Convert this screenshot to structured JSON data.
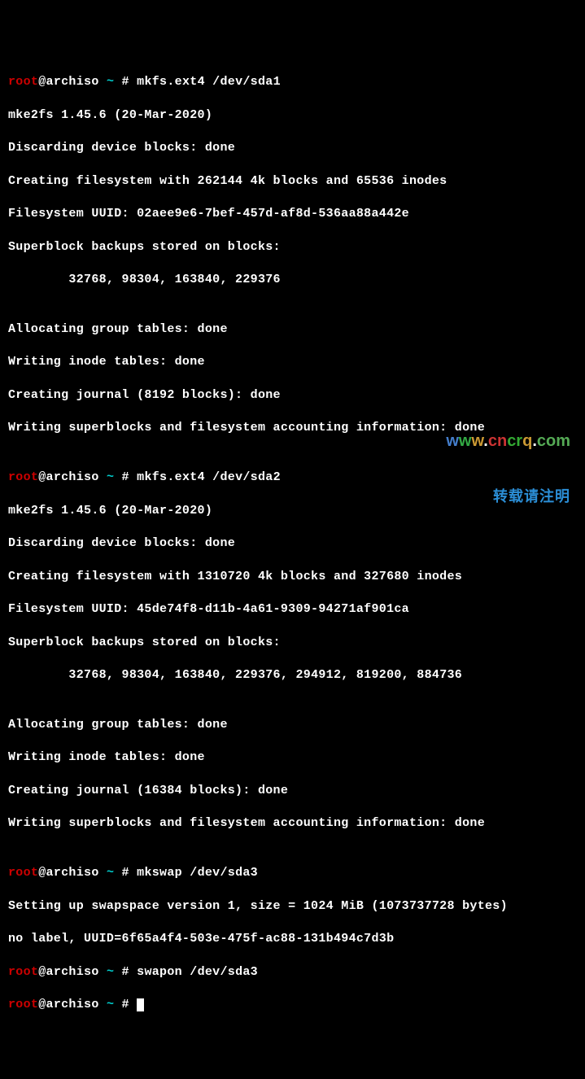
{
  "prompt1": {
    "user": "root",
    "at_host": "@archiso ",
    "tilde": "~",
    "hash": " # ",
    "cmd": "mkfs.ext4 /dev/sda1"
  },
  "block1": {
    "l1": "mke2fs 1.45.6 (20-Mar-2020)",
    "l2": "Discarding device blocks: done",
    "l3": "Creating filesystem with 262144 4k blocks and 65536 inodes",
    "l4": "Filesystem UUID: 02aee9e6-7bef-457d-af8d-536aa88a442e",
    "l5": "Superblock backups stored on blocks:",
    "l6": "        32768, 98304, 163840, 229376",
    "l7": "Allocating group tables: done",
    "l8": "Writing inode tables: done",
    "l9": "Creating journal (8192 blocks): done",
    "l10": "Writing superblocks and filesystem accounting information: done"
  },
  "prompt2": {
    "user": "root",
    "at_host": "@archiso ",
    "tilde": "~",
    "hash": " # ",
    "cmd": "mkfs.ext4 /dev/sda2"
  },
  "block2": {
    "l1": "mke2fs 1.45.6 (20-Mar-2020)",
    "l2": "Discarding device blocks: done",
    "l3": "Creating filesystem with 1310720 4k blocks and 327680 inodes",
    "l4": "Filesystem UUID: 45de74f8-d11b-4a61-9309-94271af901ca",
    "l5": "Superblock backups stored on blocks:",
    "l6": "        32768, 98304, 163840, 229376, 294912, 819200, 884736",
    "l7": "Allocating group tables: done",
    "l8": "Writing inode tables: done",
    "l9": "Creating journal (16384 blocks): done",
    "l10": "Writing superblocks and filesystem accounting information: done"
  },
  "prompt3": {
    "user": "root",
    "at_host": "@archiso ",
    "tilde": "~",
    "hash": " # ",
    "cmd": "mkswap /dev/sda3"
  },
  "block3": {
    "l1": "Setting up swapspace version 1, size = 1024 MiB (1073737728 bytes)",
    "l2": "no label, UUID=6f65a4f4-503e-475f-ac88-131b494c7d3b"
  },
  "prompt4": {
    "user": "root",
    "at_host": "@archiso ",
    "tilde": "~",
    "hash": " # ",
    "cmd": "swapon /dev/sda3"
  },
  "prompt5": {
    "user": "root",
    "at_host": "@archiso ",
    "tilde": "~",
    "hash": " # ",
    "cmd": ""
  },
  "watermark": {
    "url": "www.cncrq.com",
    "text": "转载请注明"
  }
}
